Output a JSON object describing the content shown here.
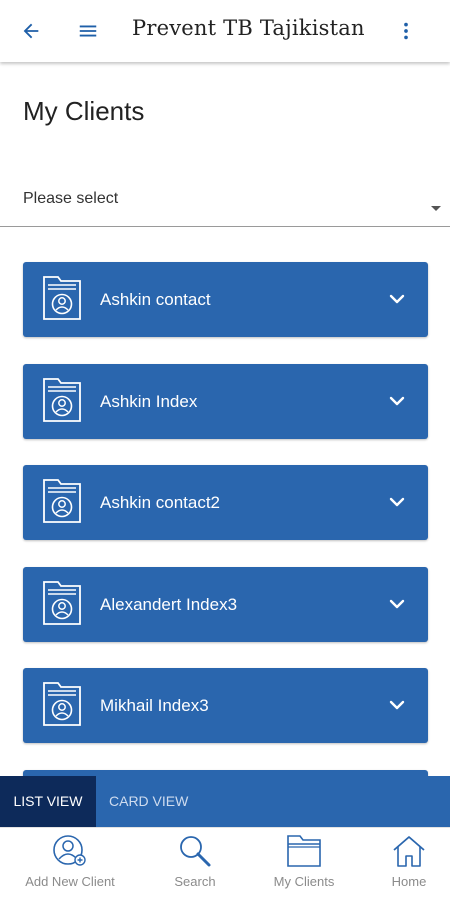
{
  "app_bar": {
    "title": "Prevent TB Tajikistan",
    "icons": [
      "back-arrow-icon",
      "hamburger-menu-icon",
      "more-vert-icon"
    ]
  },
  "page": {
    "title": "My Clients"
  },
  "filter": {
    "selected": "Please select"
  },
  "clients": [
    {
      "name": "Ashkin contact"
    },
    {
      "name": "Ashkin Index"
    },
    {
      "name": "Ashkin contact2"
    },
    {
      "name": "Alexandert Index3"
    },
    {
      "name": "Mikhail Index3"
    },
    {
      "name": ""
    }
  ],
  "view_toggle": {
    "list_view": "LIST VIEW",
    "card_view": "CARD VIEW",
    "active": "LIST VIEW"
  },
  "bottom_nav": {
    "add_new_client": "Add New Client",
    "search": "Search",
    "my_clients": "My Clients",
    "home": "Home"
  },
  "colors": {
    "card_blue": "#2a66ae",
    "dark_navy": "#0d2a5a",
    "accent_blue": "#1e5fa8",
    "nav_gray": "#8b8b8b"
  }
}
